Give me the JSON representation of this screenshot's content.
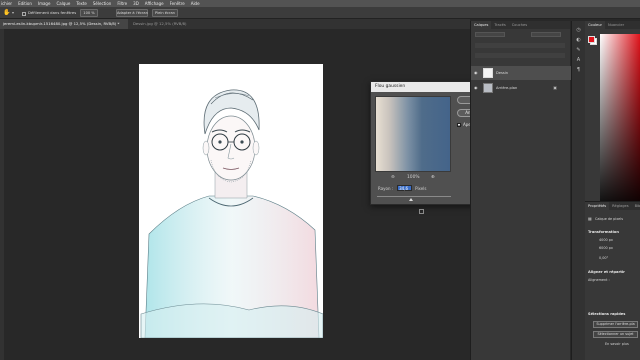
{
  "menu": [
    "ichier",
    "Edition",
    "Image",
    "Calque",
    "Texte",
    "Sélection",
    "Filtre",
    "3D",
    "Affichage",
    "Fenêtre",
    "Aide"
  ],
  "options_bar": {
    "scroll_all": "Défilement dans fenêtres",
    "zoom": "100 %",
    "fit_screen": "Adapter à l'écran",
    "fill_screen": "Plein écran"
  },
  "doc_tabs": [
    {
      "label": "jeremi-eslin-kbupmlr-1516480.jpg @ 12,5% (Dessin, RVB/8) *",
      "active": true
    },
    {
      "label": "Dessin.jpg @ 12,5% (RVB/8)",
      "active": false
    }
  ],
  "dialog": {
    "title": "Flou gaussien",
    "ok": "OK",
    "cancel": "Annuler",
    "preview_label": "Aperçu",
    "preview_checked": true,
    "zoom_out": "⊖",
    "zoom_level": "100%",
    "zoom_in": "⊕",
    "radius_label": "Rayon :",
    "radius_value": "34,6",
    "radius_unit": "Pixels",
    "radius_slider_fraction": 0.46
  },
  "layers_panel": {
    "tabs": [
      "Calques",
      "Tracés",
      "Couches"
    ],
    "layers": [
      {
        "name": "Dessin",
        "visible": true,
        "selected": true
      },
      {
        "name": "Arrière-plan",
        "visible": true,
        "selected": false,
        "locked": true
      }
    ]
  },
  "color_panel": {
    "tabs": [
      "Couleur",
      "Nuancier"
    ],
    "foreground": "#e0141c",
    "background": "#ffffff"
  },
  "properties_panel": {
    "tabs": [
      "Propriétés",
      "Réglages",
      "Bib"
    ],
    "layer_type": "Calque de pixels",
    "transform_header": "Transformation",
    "width": "4000 px",
    "height": "6000 px",
    "angle": "0,00°",
    "align_header": "Aligner et répartir",
    "align_label": "Alignement :",
    "quick_actions_header": "Sélections rapides",
    "remove_bg": "Supprimer l'arrière-pla",
    "select_subject": "Sélectionner un sujet",
    "more": "En savoir plus"
  }
}
